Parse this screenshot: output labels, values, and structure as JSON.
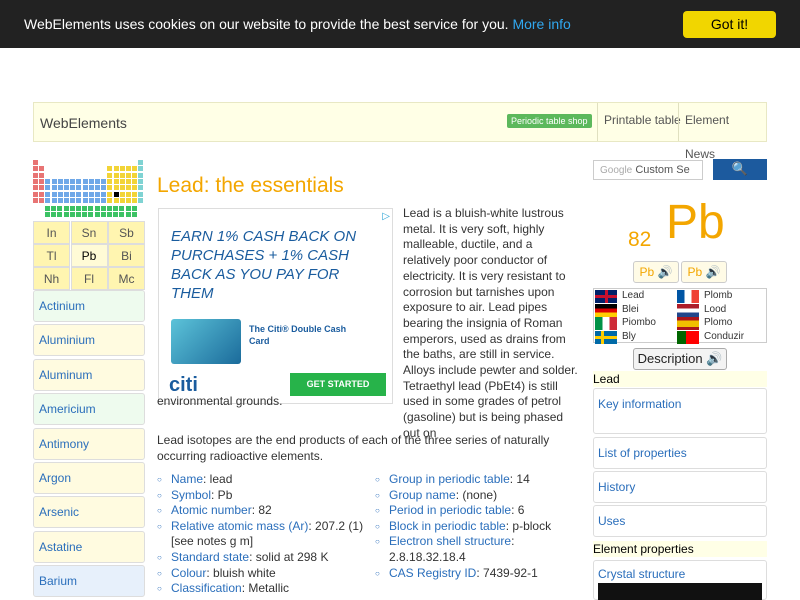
{
  "cookie": {
    "message": "WebElements uses cookies on our website to provide the best service for you.",
    "more_info": "More info",
    "button": "Got it!"
  },
  "nav": {
    "brand": "WebElements",
    "shop": "Periodic table shop",
    "printable": "Printable table",
    "news": "Element News"
  },
  "mini_grid": [
    "In",
    "Sn",
    "Sb",
    "Tl",
    "Pb",
    "Bi",
    "Nh",
    "Fl",
    "Mc"
  ],
  "element_list": [
    "Actinium",
    "Aluminium",
    "Aluminum",
    "Americium",
    "Antimony",
    "Argon",
    "Arsenic",
    "Astatine",
    "Barium"
  ],
  "title": "Lead: the essentials",
  "ad": {
    "text": "EARN 1% CASH BACK ON PURCHASES + 1% CASH BACK AS YOU PAY FOR THEM",
    "card_name": "The Citi® Double Cash Card",
    "logo": "citi",
    "cta": "GET STARTED"
  },
  "intro": "Lead is a bluish-white lustrous metal. It is very soft, highly malleable, ductile, and a relatively poor conductor of electricity. It is very resistant to corrosion but tarnishes upon exposure to air. Lead pipes bearing the insignia of Roman emperors, used as drains from the baths, are still in service. Alloys include pewter and solder. Tetraethyl lead (PbEt4) is still used in some grades of petrol (gasoline) but is being phased out on",
  "intro_end": "environmental grounds.",
  "isotopes": "Lead isotopes are the end products of each of the three series of naturally occurring radioactive elements.",
  "props_left": [
    {
      "k": "Name",
      "v": ": lead"
    },
    {
      "k": "Symbol",
      "v": ": Pb"
    },
    {
      "k": "Atomic number",
      "v": ": 82"
    },
    {
      "k": "Relative atomic mass (Ar)",
      "v": ": 207.2 (1) [see notes g m]"
    },
    {
      "k": "Standard state",
      "v": ": solid at 298 K"
    },
    {
      "k": "Colour",
      "v": ": bluish white"
    },
    {
      "k": "Classification",
      "v": ": Metallic"
    }
  ],
  "props_right": [
    {
      "k": "Group in periodic table",
      "v": ": 14"
    },
    {
      "k": "Group name",
      "v": ": (none)"
    },
    {
      "k": "Period in periodic table",
      "v": ": 6"
    },
    {
      "k": "Block in periodic table",
      "v": ": p-block"
    },
    {
      "k": "Electron shell structure",
      "v": ": 2.8.18.32.18.4"
    },
    {
      "k": "CAS Registry ID",
      "v": ": 7439-92-1"
    }
  ],
  "search": {
    "placeholder": "Custom Se",
    "prefix": "Google",
    "button": "🔍"
  },
  "element": {
    "number": "82",
    "symbol": "Pb"
  },
  "audio": [
    "Pb 🔊",
    "Pb 🔊"
  ],
  "languages": [
    {
      "name": "Lead",
      "flag": "uk"
    },
    {
      "name": "Plomb",
      "flag": "fr"
    },
    {
      "name": "Blei",
      "flag": "de"
    },
    {
      "name": "Lood",
      "flag": "nl"
    },
    {
      "name": "Piombo",
      "flag": "it"
    },
    {
      "name": "Plomo",
      "flag": "es"
    },
    {
      "name": "Bly",
      "flag": "se"
    },
    {
      "name": "Conduzir",
      "flag": "pt"
    }
  ],
  "description_btn": "Description 🔊",
  "lead_heading": "Lead",
  "lead_links": [
    "Key information",
    "List of properties",
    "History",
    "Uses"
  ],
  "props_heading": "Element properties",
  "crystal": "Crystal structure"
}
